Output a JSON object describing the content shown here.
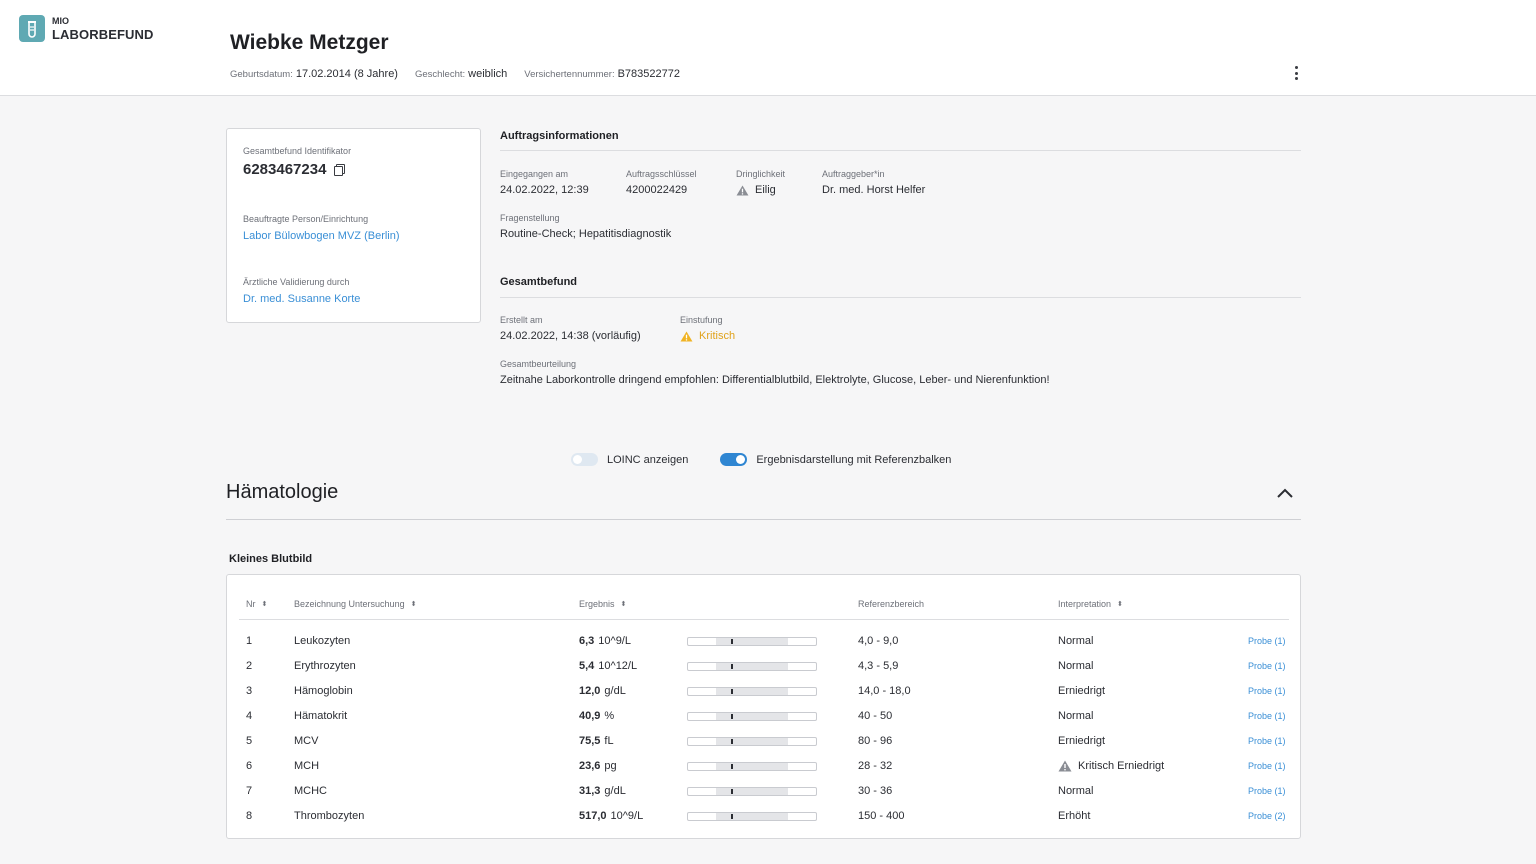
{
  "app": {
    "logo_small": "MIO",
    "logo_big": "LABORBEFUND",
    "accent_color": "#5fa9b3",
    "link_color": "#3a8fd6"
  },
  "patient": {
    "name": "Wiebke Metzger",
    "birth_label": "Geburtsdatum:",
    "birth_value": "17.02.2014 (8 Jahre)",
    "gender_label": "Geschlecht:",
    "gender_value": "weiblich",
    "insurance_label": "Versichertennummer:",
    "insurance_value": "B783522772"
  },
  "summary_card": {
    "id_label": "Gesamtbefund Identifikator",
    "id_value": "6283467234",
    "assigned_label": "Beauftragte Person/Einrichtung",
    "assigned_value": "Labor Bülowbogen MVZ (Berlin)",
    "validation_label": "Ärztliche Validierung durch",
    "validation_value": "Dr. med. Susanne Korte"
  },
  "order_info": {
    "title": "Auftragsinformationen",
    "received_label": "Eingegangen am",
    "received_value": "24.02.2022, 12:39",
    "key_label": "Auftragsschlüssel",
    "key_value": "4200022429",
    "urgency_label": "Dringlichkeit",
    "urgency_value": "Eilig",
    "orderer_label": "Auftraggeber*in",
    "orderer_value": "Dr. med. Horst Helfer",
    "question_label": "Fragenstellung",
    "question_value": "Routine-Check; Hepatitisdiagnostik"
  },
  "overall_result": {
    "title": "Gesamtbefund",
    "created_label": "Erstellt am",
    "created_value": "24.02.2022, 14:38 (vorläufig)",
    "rating_label": "Einstufung",
    "rating_value": "Kritisch",
    "rating_color": "#e0a21a",
    "assessment_label": "Gesamtbeurteilung",
    "assessment_value": "Zeitnahe Laborkontrolle dringend empfohlen: Differentialblutbild, Elektrolyte, Glucose, Leber- und Nierenfunktion!"
  },
  "toggles": {
    "loinc_label": "LOINC anzeigen",
    "loinc_on": false,
    "refbar_label": "Ergebnisdarstellung mit Referenzbalken",
    "refbar_on": true
  },
  "section": {
    "title": "Hämatologie",
    "subtitle": "Kleines Blutbild"
  },
  "table": {
    "headers": {
      "nr": "Nr",
      "name": "Bezeichnung Untersuchung",
      "result": "Ergebnis",
      "reference": "Referenzbereich",
      "interpretation": "Interpretation"
    },
    "rows": [
      {
        "nr": "1",
        "name": "Leukozyten",
        "value": "6,3",
        "unit": "10^9/L",
        "reference": "4,0 - 9,0",
        "interpretation": "Normal",
        "critical": false,
        "probe": "Probe (1)"
      },
      {
        "nr": "2",
        "name": "Erythrozyten",
        "value": "5,4",
        "unit": "10^12/L",
        "reference": "4,3 - 5,9",
        "interpretation": "Normal",
        "critical": false,
        "probe": "Probe (1)"
      },
      {
        "nr": "3",
        "name": "Hämoglobin",
        "value": "12,0",
        "unit": "g/dL",
        "reference": "14,0 - 18,0",
        "interpretation": "Erniedrigt",
        "critical": false,
        "probe": "Probe (1)"
      },
      {
        "nr": "4",
        "name": "Hämatokrit",
        "value": "40,9",
        "unit": "%",
        "reference": "40 - 50",
        "interpretation": "Normal",
        "critical": false,
        "probe": "Probe (1)"
      },
      {
        "nr": "5",
        "name": "MCV",
        "value": "75,5",
        "unit": "fL",
        "reference": "80 - 96",
        "interpretation": "Erniedrigt",
        "critical": false,
        "probe": "Probe (1)"
      },
      {
        "nr": "6",
        "name": "MCH",
        "value": "23,6",
        "unit": "pg",
        "reference": "28 - 32",
        "interpretation": "Kritisch Erniedrigt",
        "critical": true,
        "probe": "Probe (1)"
      },
      {
        "nr": "7",
        "name": "MCHC",
        "value": "31,3",
        "unit": "g/dL",
        "reference": "30 - 36",
        "interpretation": "Normal",
        "critical": false,
        "probe": "Probe (1)"
      },
      {
        "nr": "8",
        "name": "Thrombozyten",
        "value": "517,0",
        "unit": "10^9/L",
        "reference": "150 - 400",
        "interpretation": "Erhöht",
        "critical": false,
        "probe": "Probe (2)"
      }
    ]
  }
}
